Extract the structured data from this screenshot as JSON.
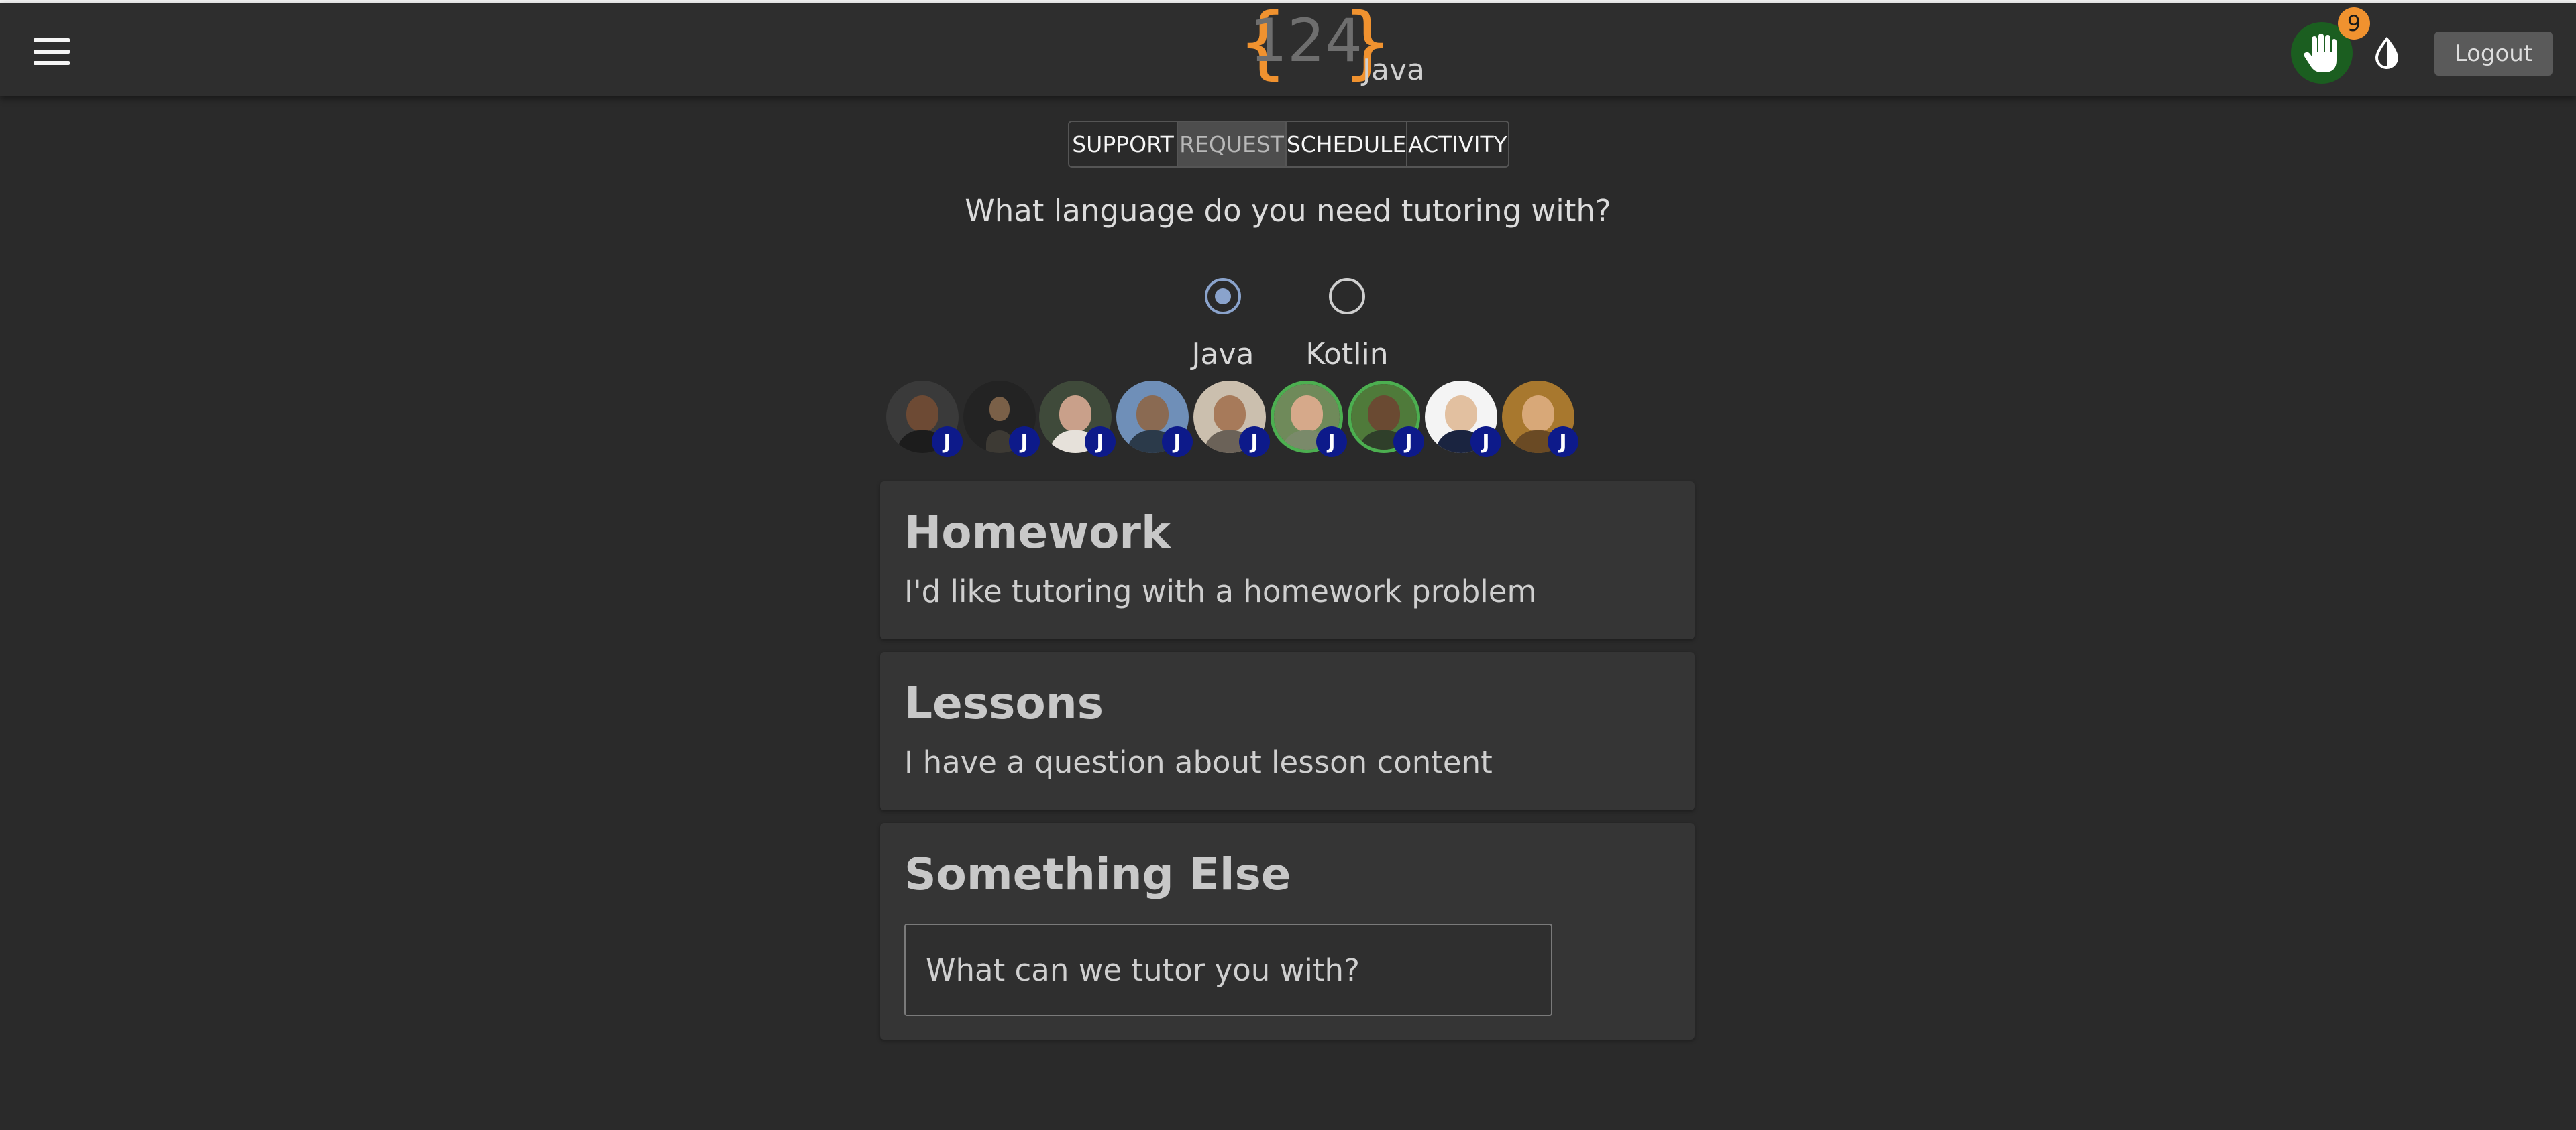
{
  "header": {
    "logo_number": "124",
    "logo_course": "Java",
    "notification_count": "9",
    "logout_label": "Logout"
  },
  "tabs": [
    {
      "label": "SUPPORT",
      "active": false
    },
    {
      "label": "REQUEST",
      "active": true
    },
    {
      "label": "SCHEDULE",
      "active": false
    },
    {
      "label": "ACTIVITY",
      "active": false
    }
  ],
  "request": {
    "question": "What language do you need tutoring with?",
    "languages": [
      {
        "label": "Java",
        "selected": true
      },
      {
        "label": "Kotlin",
        "selected": false
      }
    ]
  },
  "tutors": [
    {
      "badge": "J",
      "online": false
    },
    {
      "badge": "J",
      "online": false
    },
    {
      "badge": "J",
      "online": false
    },
    {
      "badge": "J",
      "online": false
    },
    {
      "badge": "J",
      "online": false
    },
    {
      "badge": "J",
      "online": true
    },
    {
      "badge": "J",
      "online": true
    },
    {
      "badge": "J",
      "online": false
    },
    {
      "badge": "J",
      "online": false
    }
  ],
  "options": {
    "homework": {
      "title": "Homework",
      "description": "I'd like tutoring with a homework problem"
    },
    "lessons": {
      "title": "Lessons",
      "description": "I have a question about lesson content"
    },
    "other": {
      "title": "Something Else",
      "placeholder": "What can we tutor you with?",
      "value": ""
    }
  },
  "colors": {
    "accent": "#f0922f",
    "hand_button": "#1b5e20",
    "online_ring": "#4caf50",
    "badge": "#0d1a8a",
    "radio_selected": "#8aa3cc"
  }
}
